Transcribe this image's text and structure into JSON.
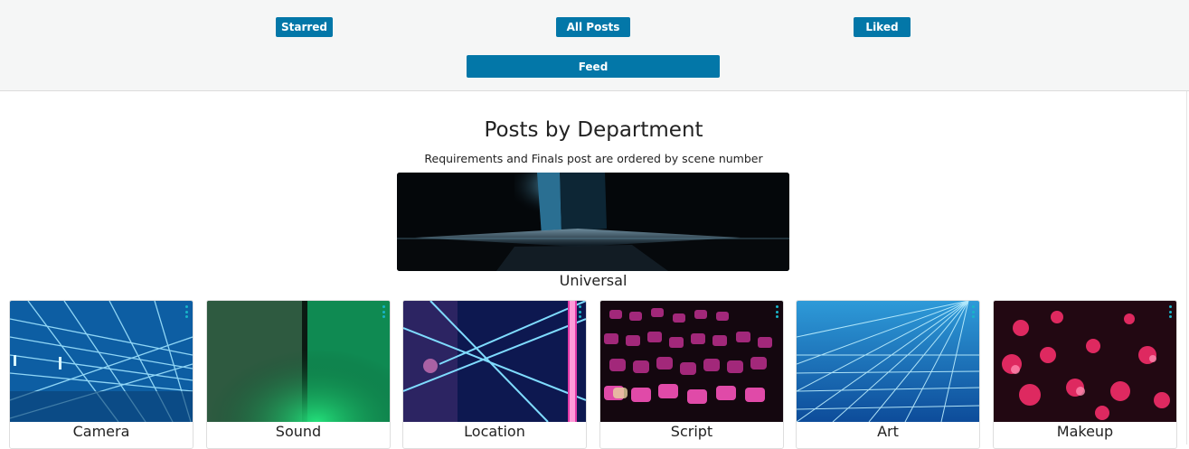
{
  "nav": {
    "starred": "Starred",
    "all_posts": "All Posts",
    "liked": "Liked",
    "feed": "Feed"
  },
  "main": {
    "title": "Posts by Department",
    "subtitle": "Requirements and Finals post are ordered by scene number",
    "featured": {
      "label": "Universal"
    },
    "departments": [
      {
        "label": "Camera"
      },
      {
        "label": "Sound"
      },
      {
        "label": "Location"
      },
      {
        "label": "Script"
      },
      {
        "label": "Art"
      },
      {
        "label": "Makeup"
      }
    ]
  },
  "colors": {
    "button": "#0377a8",
    "menu_dots": "#19b4c8",
    "topbar": "#f5f6f6"
  },
  "icons": {
    "card_menu": "more-vertical-icon"
  }
}
